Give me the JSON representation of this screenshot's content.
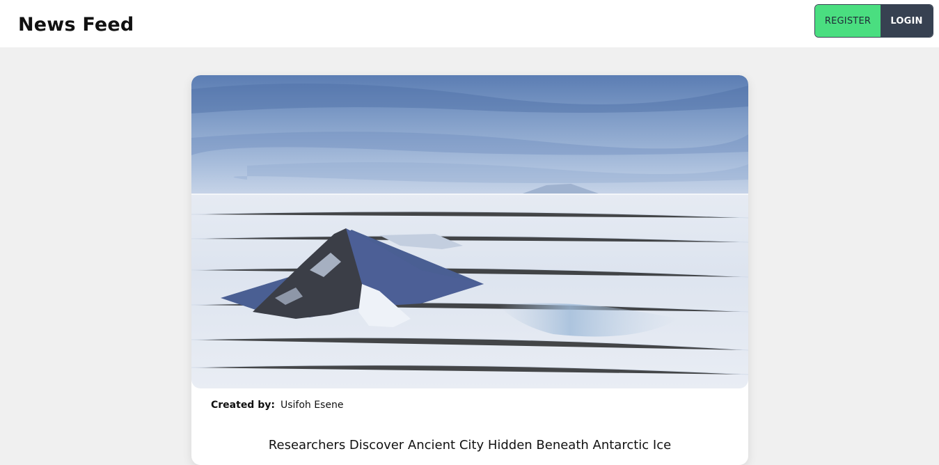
{
  "header": {
    "title": "News Feed",
    "register_label": "REGISTER",
    "login_label": "LOGIN"
  },
  "colors": {
    "register_bg": "#4ade80",
    "login_bg": "#374151",
    "page_bg": "#f0f0f0"
  },
  "article": {
    "created_by_label": "Created by:",
    "author": "Usifoh Esene",
    "title": "Researchers Discover Ancient City Hidden Beneath Antarctic Ice"
  }
}
